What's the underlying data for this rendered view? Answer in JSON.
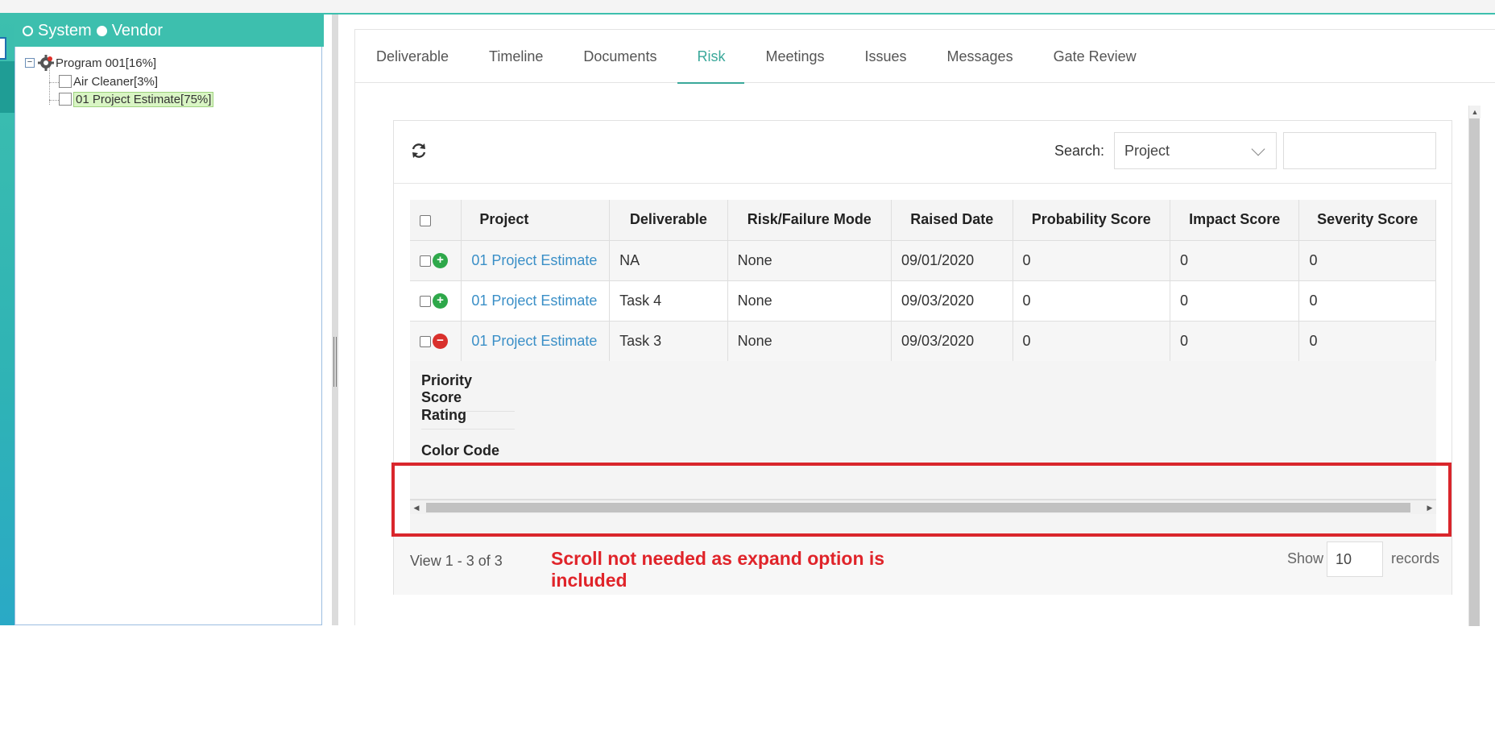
{
  "sidebar": {
    "radio_system": "System",
    "radio_vendor": "Vendor",
    "tree": {
      "root": "Program 001[16%]",
      "child1": "Air Cleaner[3%]",
      "child2": "01 Project Estimate[75%]"
    }
  },
  "tabs": [
    "Deliverable",
    "Timeline",
    "Documents",
    "Risk",
    "Meetings",
    "Issues",
    "Messages",
    "Gate Review"
  ],
  "active_tab": "Risk",
  "toolbar": {
    "search_label": "Search:",
    "search_field_value": "Project",
    "search_input_value": ""
  },
  "table": {
    "columns": [
      "Project",
      "Deliverable",
      "Risk/Failure Mode",
      "Raised Date",
      "Probability Score",
      "Impact Score",
      "Severity Score"
    ],
    "rows": [
      {
        "expand": "+",
        "project": "01 Project Estimate",
        "deliverable": "NA",
        "risk": "None",
        "date": "09/01/2020",
        "probability": "0",
        "impact": "0",
        "severity": "0"
      },
      {
        "expand": "+",
        "project": "01 Project Estimate",
        "deliverable": "Task 4",
        "risk": "None",
        "date": "09/03/2020",
        "probability": "0",
        "impact": "0",
        "severity": "0"
      },
      {
        "expand": "−",
        "project": "01 Project Estimate",
        "deliverable": "Task 3",
        "risk": "None",
        "date": "09/03/2020",
        "probability": "0",
        "impact": "0",
        "severity": "0"
      }
    ],
    "expanded_fields": [
      "Priority Score",
      "Rating",
      "Color Code"
    ]
  },
  "pager": {
    "view_text": "View 1 - 3 of 3",
    "show_label": "Show",
    "records_value": "10",
    "records_label": "records"
  },
  "annotation": {
    "text": "Scroll not needed as expand option is included",
    "color": "#e0242a"
  },
  "colors": {
    "accent": "#3dbfae",
    "link": "#3a8fc7",
    "plus": "#2ea84a",
    "minus": "#d9302c"
  }
}
